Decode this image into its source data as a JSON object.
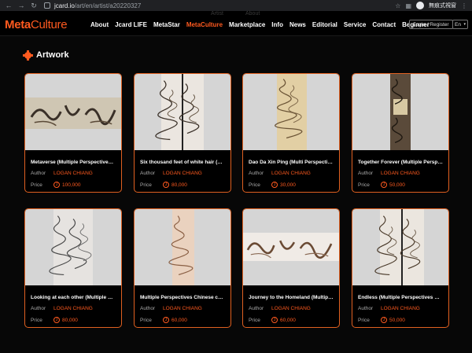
{
  "browser": {
    "back_icon": "arrow-left-icon",
    "forward_icon": "arrow-right-icon",
    "reload_icon": "reload-icon",
    "url_host": "jcard.io",
    "url_path": "/art/en/artist/a20220327",
    "profile_label": "無痕式視窗"
  },
  "header": {
    "ghost_items": [
      "Artist",
      "About"
    ],
    "logo_a": "Meta",
    "logo_b": "Culture",
    "menu": [
      "About",
      "Jcard LIFE",
      "MetaStar",
      "MetaCulture",
      "Marketplace",
      "Info",
      "News",
      "Editorial",
      "Service",
      "Contact",
      "Beginner"
    ],
    "active_menu": "MetaCulture",
    "login_label": "Login / Register",
    "lang_label": "En",
    "colors": {
      "accent": "#ff5a1f",
      "background": "#070707"
    }
  },
  "section": {
    "title": "Artwork"
  },
  "labels": {
    "author": "Author",
    "price": "Price"
  },
  "artworks": [
    {
      "title": "Metaverse (Multiple Perspectives ...",
      "author": "LOGAN CHIANG",
      "price": "100,000",
      "layout": "wide"
    },
    {
      "title": "Six thousand feet of white hair (Mu...",
      "author": "LOGAN CHIANG",
      "price": "80,000",
      "layout": "double"
    },
    {
      "title": "Dao Da Xin Ping (Multi Perspective ...",
      "author": "LOGAN CHIANG",
      "price": "30,000",
      "layout": "tan"
    },
    {
      "title": "Together Forever (Multiple Perspec...",
      "author": "LOGAN CHIANG",
      "price": "50,000",
      "layout": "dark"
    },
    {
      "title": "Looking at each other (Multiple Per...",
      "author": "LOGAN CHIANG",
      "price": "80,000",
      "layout": "grey"
    },
    {
      "title": "Multiple Perspectives Chinese calli...",
      "author": "LOGAN CHIANG",
      "price": "60,000",
      "layout": "peach"
    },
    {
      "title": "Journey to the Homeland (Multiple ...",
      "author": "LOGAN CHIANG",
      "price": "60,000",
      "layout": "wide2"
    },
    {
      "title": "Endless (Multiple Perspectives Chi...",
      "author": "LOGAN CHIANG",
      "price": "50,000",
      "layout": "double2"
    }
  ]
}
